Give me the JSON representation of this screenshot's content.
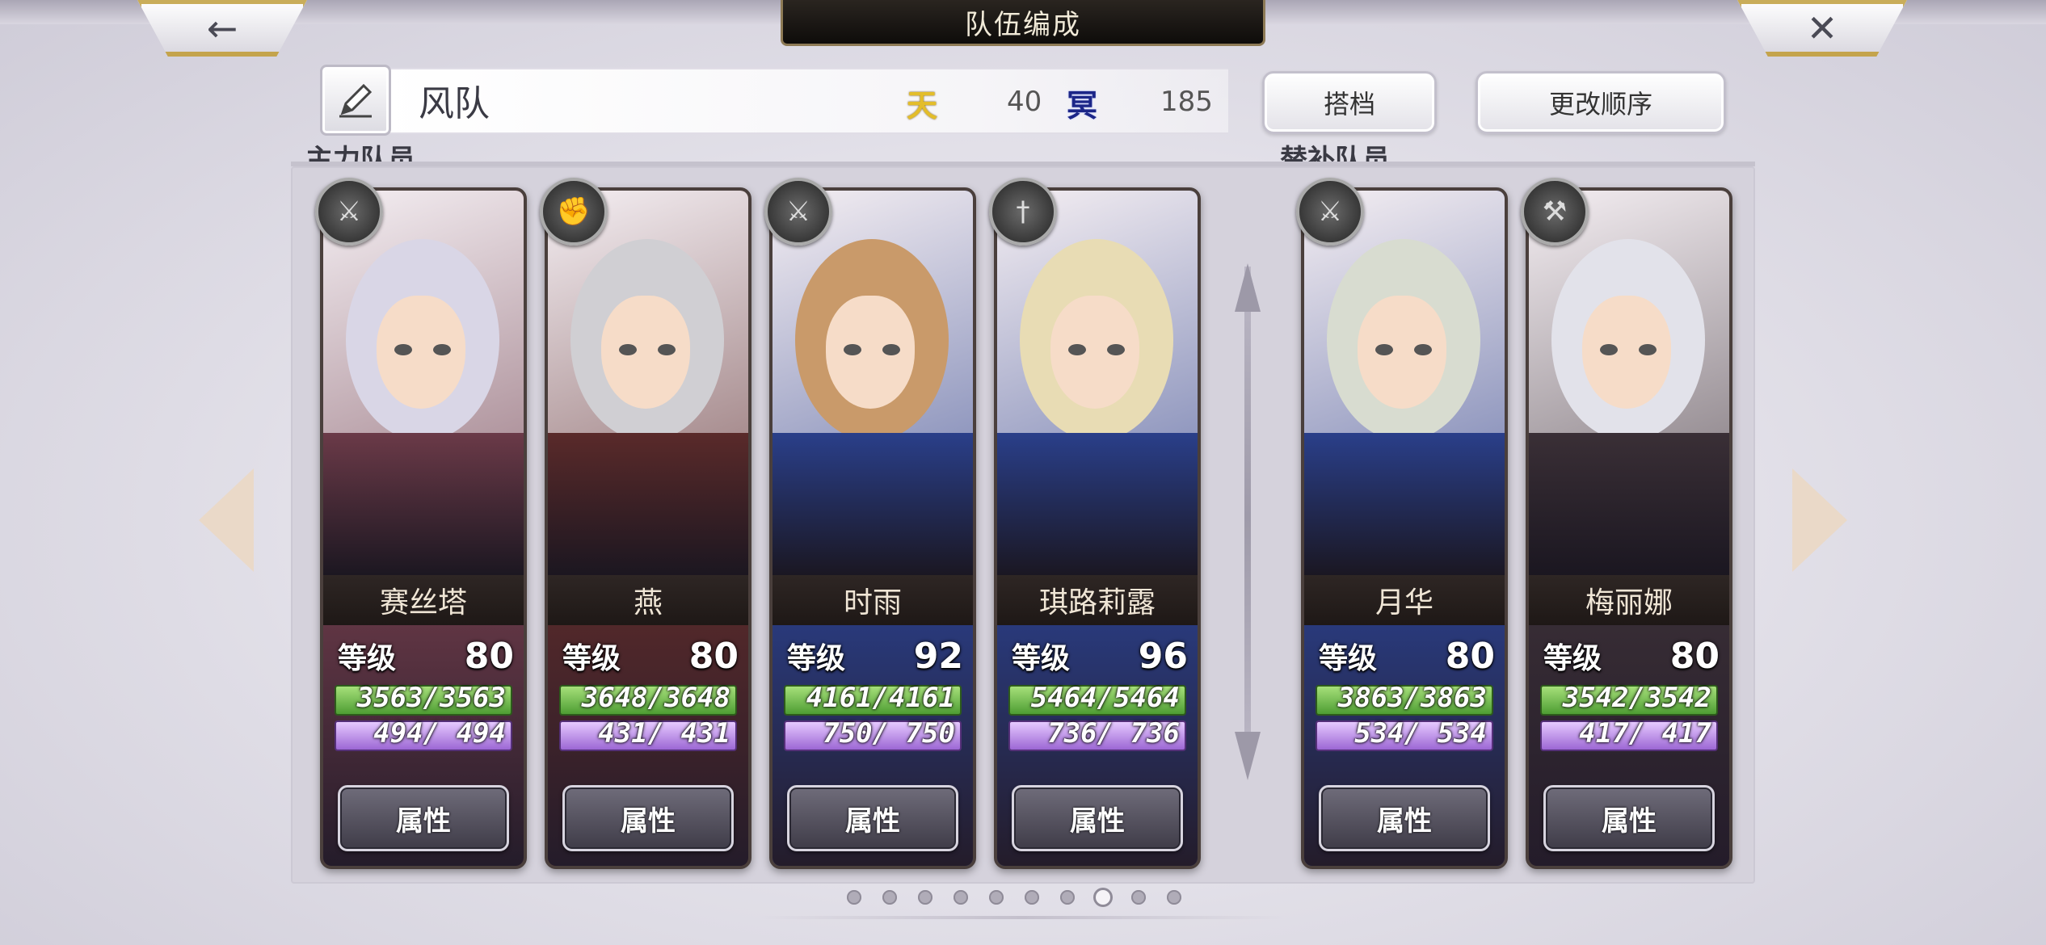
{
  "title": "队伍编成",
  "nav": {
    "back_icon": "←",
    "close_icon": "✕"
  },
  "team": {
    "name": "风队",
    "sky_label": "天",
    "sky_value": "40",
    "dark_label": "冥",
    "dark_value": "185"
  },
  "buttons": {
    "partner": "搭档",
    "change_order": "更改顺序"
  },
  "sections": {
    "main": "主力队员",
    "sub": "替补队员"
  },
  "level_label": "等级",
  "attr_label": "属性",
  "members": [
    {
      "name": "赛丝塔",
      "level": "80",
      "hp": "3563/3563",
      "mp": "494/ 494",
      "weapon": "sword",
      "theme": "#6b3a48"
    },
    {
      "name": "燕",
      "level": "80",
      "hp": "3648/3648",
      "mp": "431/ 431",
      "weapon": "fist",
      "theme": "#5a2a2a"
    },
    {
      "name": "时雨",
      "level": "92",
      "hp": "4161/4161",
      "mp": "750/ 750",
      "weapon": "sword",
      "theme": "#2a3f8a"
    },
    {
      "name": "琪路莉露",
      "level": "96",
      "hp": "5464/5464",
      "mp": "736/ 736",
      "weapon": "dagger",
      "theme": "#2a3f8a"
    }
  ],
  "subs": [
    {
      "name": "月华",
      "level": "80",
      "hp": "3863/3863",
      "mp": "534/ 534",
      "weapon": "sword",
      "theme": "#2a3f8a"
    },
    {
      "name": "梅丽娜",
      "level": "80",
      "hp": "3542/3542",
      "mp": "417/ 417",
      "weapon": "hammer",
      "theme": "#3a2f36"
    }
  ],
  "pages": {
    "total": 10,
    "current": 8
  }
}
